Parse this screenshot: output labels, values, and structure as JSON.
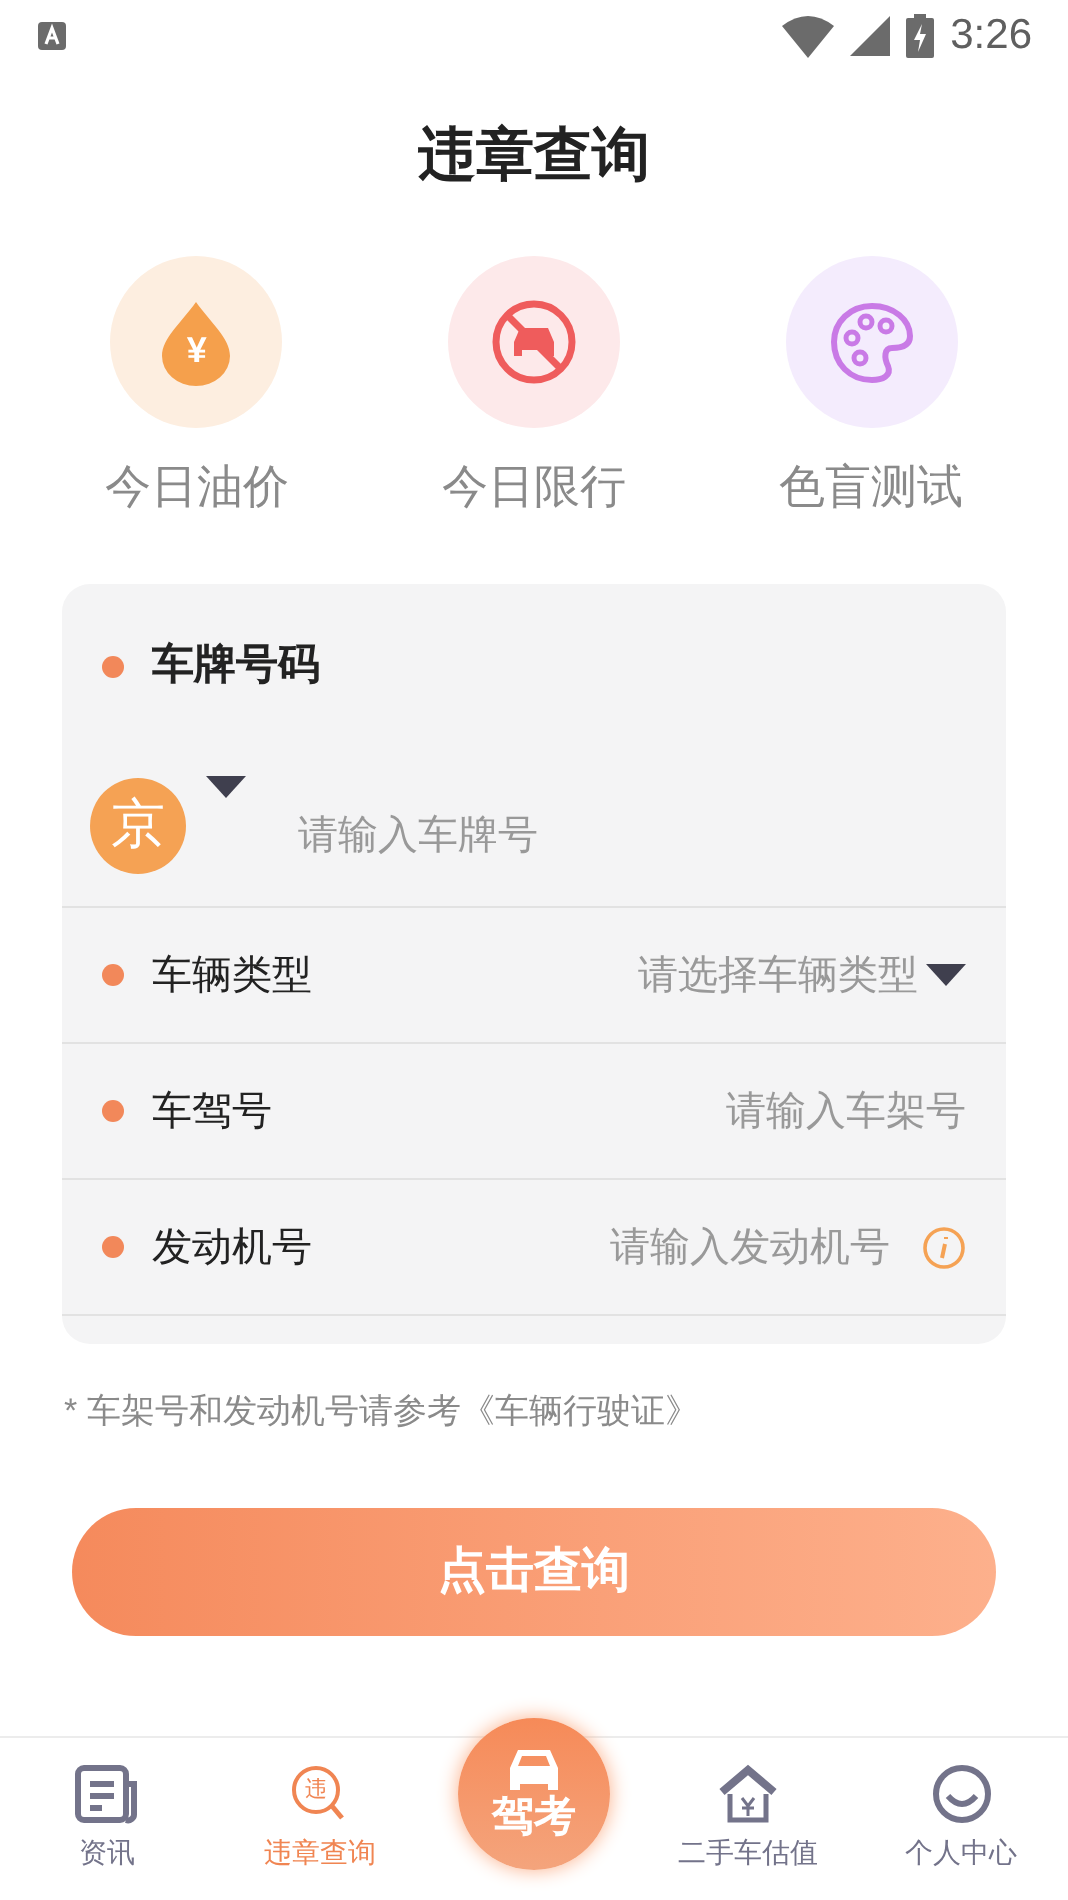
{
  "status_bar": {
    "time": "3:26"
  },
  "title": "违章查询",
  "shortcuts": [
    {
      "kind": "oil",
      "label": "今日油价",
      "symbol": "¥",
      "color": "#f5a04c"
    },
    {
      "kind": "restrict",
      "label": "今日限行",
      "color": "#ef5c5c"
    },
    {
      "kind": "palette",
      "label": "色盲测试",
      "color": "#c97ae6"
    }
  ],
  "form": {
    "plate": {
      "label": "车牌号码",
      "province": "京",
      "placeholder": "请输入车牌号"
    },
    "fields": [
      {
        "kind": "select",
        "label": "车辆类型",
        "placeholder": "请选择车辆类型"
      },
      {
        "kind": "input",
        "label": "车驾号",
        "placeholder": "请输入车架号"
      },
      {
        "kind": "input_info",
        "label": "发动机号",
        "placeholder": "请输入发动机号"
      }
    ]
  },
  "note": "* 车架号和发动机号请参考《车辆行驶证》",
  "submit": "点击查询",
  "tabs": [
    {
      "kind": "news",
      "label": "资讯",
      "selected": false
    },
    {
      "kind": "violation",
      "label": "违章查询",
      "symbol": "违",
      "selected": true
    },
    {
      "kind": "center",
      "label": "驾考",
      "selected": false
    },
    {
      "kind": "house",
      "label": "二手车估值",
      "selected": false
    },
    {
      "kind": "person",
      "label": "个人中心",
      "selected": false
    }
  ]
}
